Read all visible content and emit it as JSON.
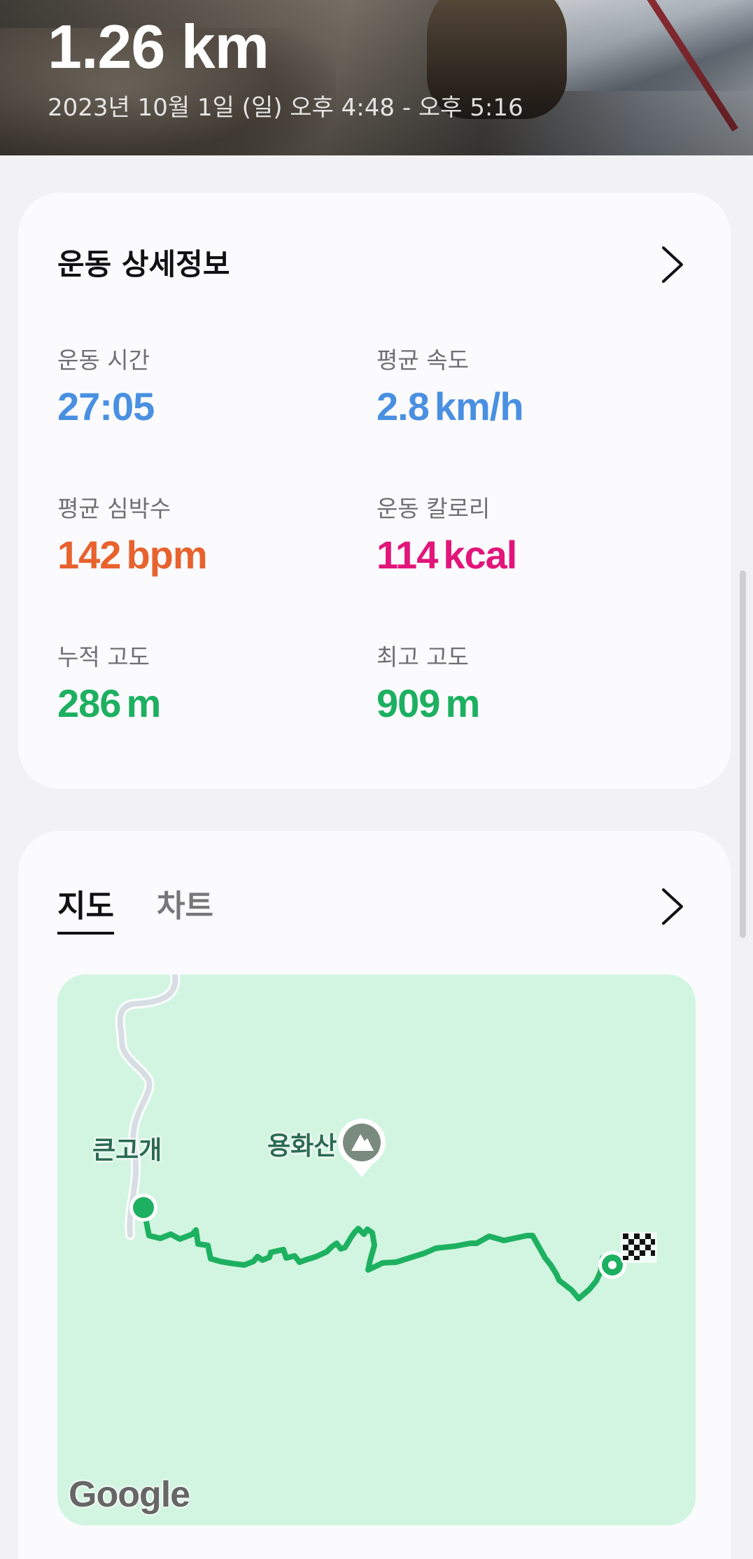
{
  "hero": {
    "distance": "1.26 km",
    "date": "2023년 10월 1일 (일) 오후 4:48 - 오후 5:16"
  },
  "details": {
    "title": "운동 상세정보",
    "metrics": [
      {
        "label": "운동 시간",
        "value": "27:05",
        "unit": "",
        "color": "#4a90e2"
      },
      {
        "label": "평균 속도",
        "value": "2.8",
        "unit": "km/h",
        "color": "#4a90e2"
      },
      {
        "label": "평균 심박수",
        "value": "142",
        "unit": "bpm",
        "color": "#e8622e"
      },
      {
        "label": "운동 칼로리",
        "value": "114",
        "unit": "kcal",
        "color": "#e2157a"
      },
      {
        "label": "누적 고도",
        "value": "286",
        "unit": "m",
        "color": "#1db060"
      },
      {
        "label": "최고 고도",
        "value": "909",
        "unit": "m",
        "color": "#1db060"
      }
    ]
  },
  "map_section": {
    "tabs": [
      {
        "label": "지도",
        "active": true
      },
      {
        "label": "차트",
        "active": false
      }
    ],
    "map": {
      "places": {
        "pass": "큰고개",
        "mountain": "용화산"
      },
      "attribution": "Google",
      "route_color": "#1db060",
      "land_color": "#d2f5e1"
    }
  }
}
